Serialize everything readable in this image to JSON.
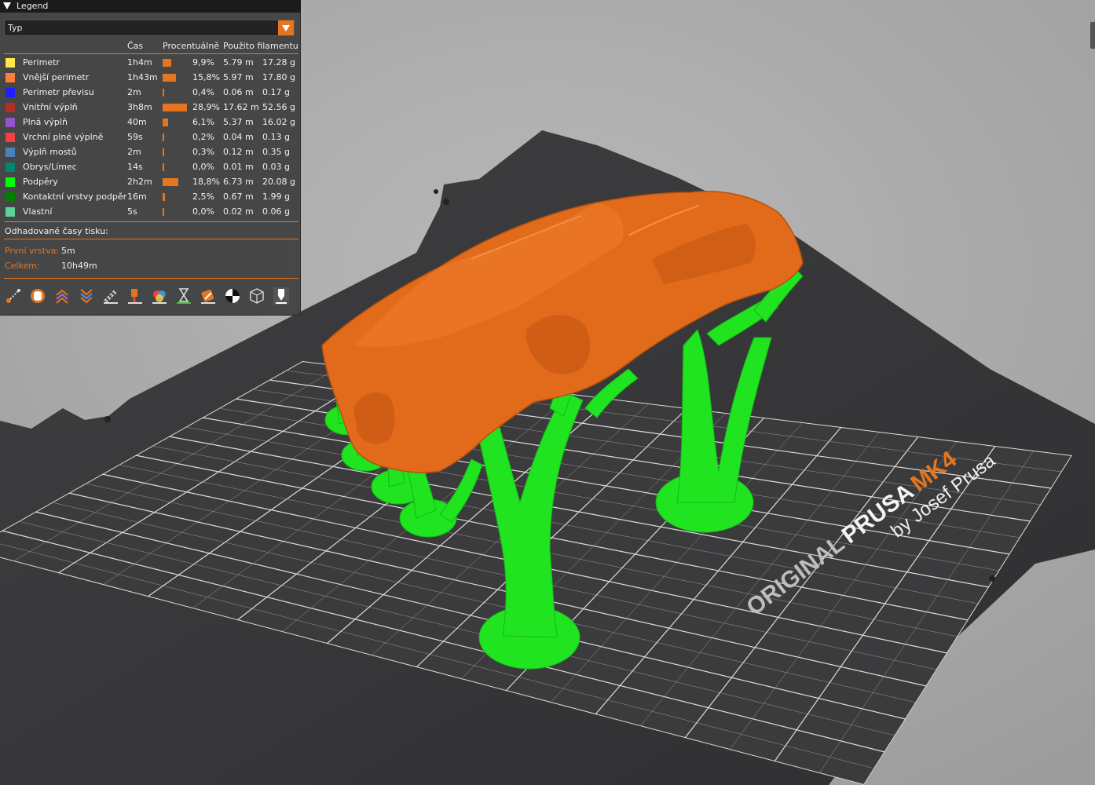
{
  "legend": {
    "title": "Legend",
    "view_type": "Typ",
    "columns": {
      "time": "Čas",
      "percent": "Procentuálně",
      "filament": "Použito filamentu"
    },
    "rows": [
      {
        "name": "Perimetr",
        "time": "1h4m",
        "pct": "9,9%",
        "pct_value": 9.9,
        "length": "5.79 m",
        "weight": "17.28 g",
        "color": "#ffe64d"
      },
      {
        "name": "Vnější perimetr",
        "time": "1h43m",
        "pct": "15,8%",
        "pct_value": 15.8,
        "length": "5.97 m",
        "weight": "17.80 g",
        "color": "#ff7d38"
      },
      {
        "name": "Perimetr převisu",
        "time": "2m",
        "pct": "0,4%",
        "pct_value": 0.4,
        "length": "0.06 m",
        "weight": "0.17 g",
        "color": "#1f1fff"
      },
      {
        "name": "Vnitřní výplň",
        "time": "3h8m",
        "pct": "28,9%",
        "pct_value": 28.9,
        "length": "17.62 m",
        "weight": "52.56 g",
        "color": "#b03029"
      },
      {
        "name": "Plná výplň",
        "time": "40m",
        "pct": "6,1%",
        "pct_value": 6.1,
        "length": "5.37 m",
        "weight": "16.02 g",
        "color": "#9654cc"
      },
      {
        "name": "Vrchní plné výplně",
        "time": "59s",
        "pct": "0,2%",
        "pct_value": 0.2,
        "length": "0.04 m",
        "weight": "0.13 g",
        "color": "#f04040"
      },
      {
        "name": "Výplň mostů",
        "time": "2m",
        "pct": "0,3%",
        "pct_value": 0.3,
        "length": "0.12 m",
        "weight": "0.35 g",
        "color": "#4d80ba"
      },
      {
        "name": "Obrys/Límec",
        "time": "14s",
        "pct": "0,0%",
        "pct_value": 0.0,
        "length": "0.01 m",
        "weight": "0.03 g",
        "color": "#00876e"
      },
      {
        "name": "Podpěry",
        "time": "2h2m",
        "pct": "18,8%",
        "pct_value": 18.8,
        "length": "6.73 m",
        "weight": "20.08 g",
        "color": "#00ff00"
      },
      {
        "name": "Kontaktní vrstvy podpěr",
        "time": "16m",
        "pct": "2,5%",
        "pct_value": 2.5,
        "length": "0.67 m",
        "weight": "1.99 g",
        "color": "#008000"
      },
      {
        "name": "Vlastní",
        "time": "5s",
        "pct": "0,0%",
        "pct_value": 0.0,
        "length": "0.02 m",
        "weight": "0.06 g",
        "color": "#5ed194"
      }
    ],
    "estimates": {
      "title": "Odhadované časy tisku:",
      "first_layer_label": "První vrstva:",
      "first_layer_value": "5m",
      "total_label": "Celkem:",
      "total_value": "10h49m"
    },
    "toolbar_icons": [
      "travel-icon",
      "wipe-icon",
      "retractions-icon",
      "deretractions-icon",
      "seams-icon",
      "tool-changes-icon",
      "color-changes-icon",
      "pause-icon",
      "custom-gcode-icon",
      "center-of-gravity-icon",
      "shells-icon",
      "tool-marker-icon"
    ]
  },
  "bed": {
    "brand_original": "ORIGINAL",
    "brand_prusa": "PRUSA",
    "brand_model": "MK4",
    "brand_by": "by Josef Prusa",
    "colors": {
      "bed": "#3a3a3c",
      "grid": "#e8e8e8",
      "model": "#e56a1c",
      "support": "#1ee61e",
      "background": "#a7a7a7",
      "accent": "#e5761f"
    }
  }
}
